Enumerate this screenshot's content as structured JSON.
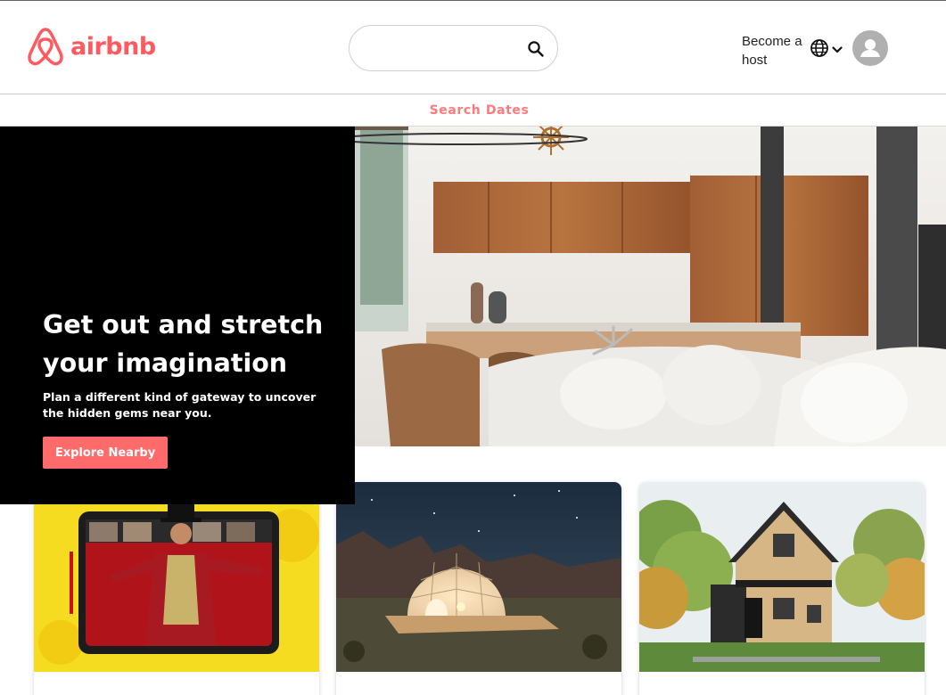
{
  "header": {
    "logo_text": "airbnb",
    "search": {
      "value": "",
      "placeholder": ""
    },
    "become_host_label": "Become a host",
    "brand_color": "#ff5a5f",
    "icons": {
      "search": "search-icon",
      "globe": "globe-icon",
      "chevron": "chevron-down-icon",
      "avatar": "user-avatar-icon"
    }
  },
  "date_bar": {
    "search_dates_label": "Search Dates"
  },
  "hero": {
    "title": "Get out and stretch your imagination",
    "subtitle": "Plan a different kind of gateway to uncover the hidden gems near you.",
    "cta_label": "Explore Nearby",
    "cta_color": "#ff6b6b"
  },
  "cards": [
    {
      "image": "online-experience-performer"
    },
    {
      "image": "glamping-dome-night"
    },
    {
      "image": "modern-cabin-forest"
    }
  ]
}
